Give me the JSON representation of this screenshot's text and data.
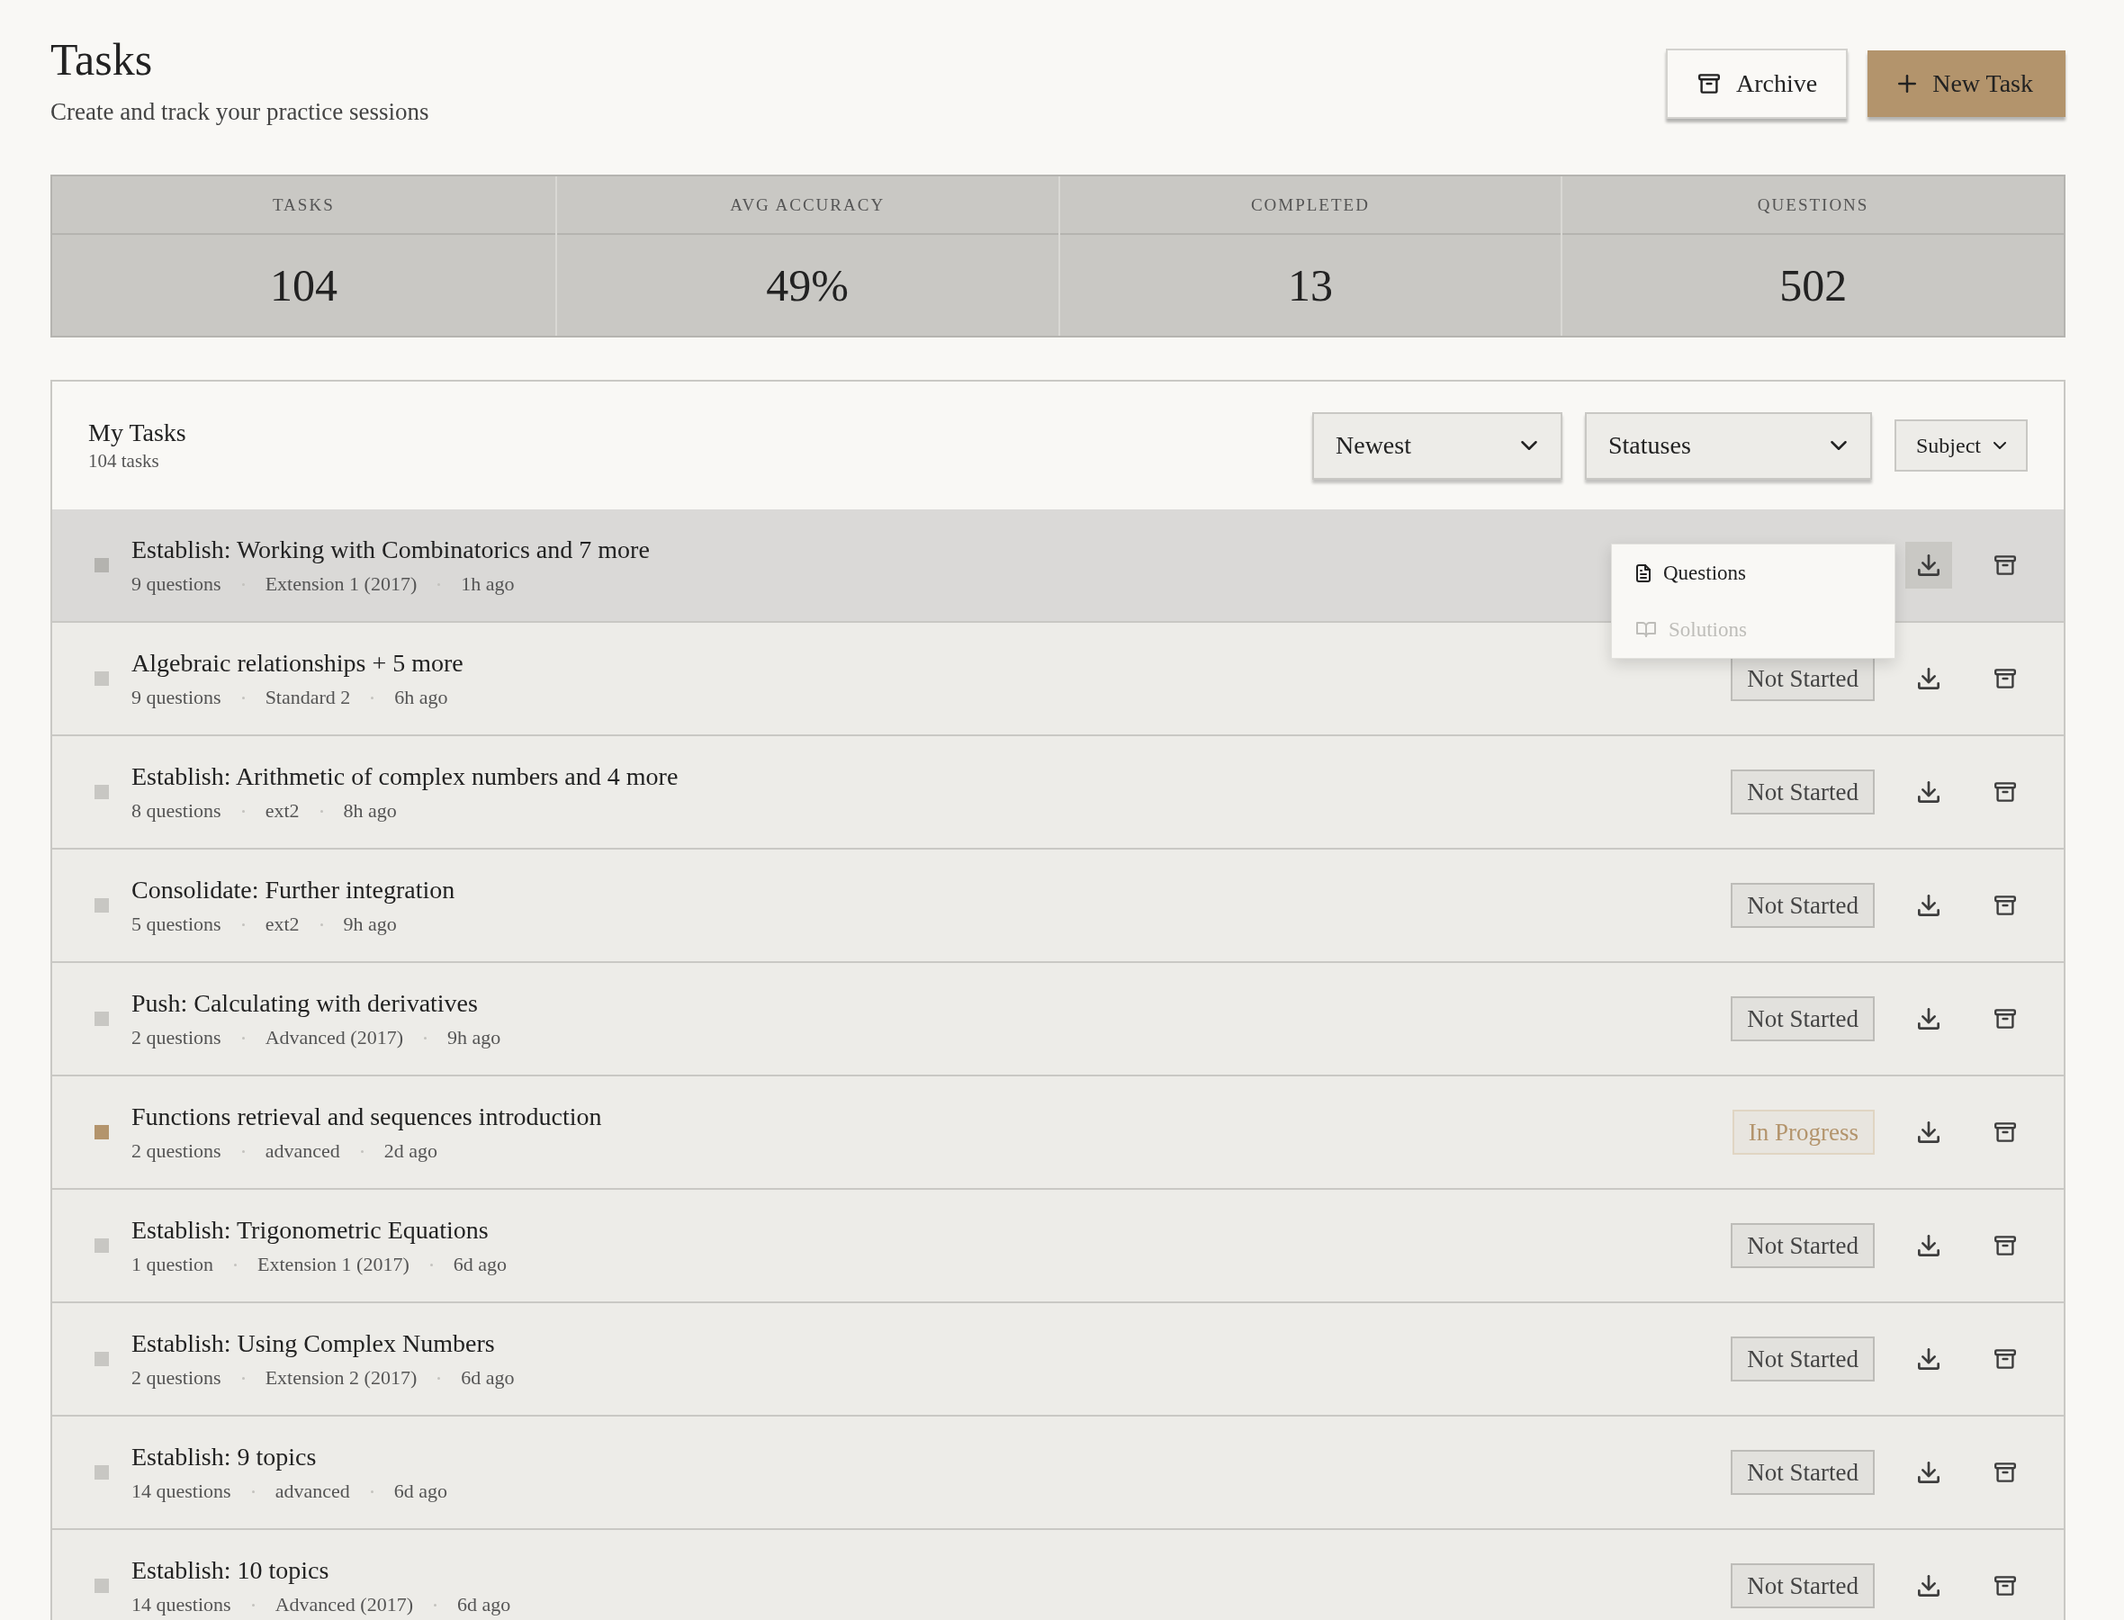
{
  "header": {
    "title": "Tasks",
    "subtitle": "Create and track your practice sessions",
    "buttons": [
      {
        "label": "Archive",
        "kind": "secondary"
      },
      {
        "label": "New Task",
        "kind": "primary"
      }
    ]
  },
  "stats": [
    {
      "label": "TASKS",
      "value": "104"
    },
    {
      "label": "AVG ACCURACY",
      "value": "49%"
    },
    {
      "label": "COMPLETED",
      "value": "13"
    },
    {
      "label": "QUESTIONS",
      "value": "502"
    }
  ],
  "task_list": {
    "title": "My Tasks",
    "count": "104 tasks",
    "filters": [
      {
        "label": "Newest",
        "kind": "large"
      },
      {
        "label": "Statuses",
        "kind": "large"
      },
      {
        "label": "Subject",
        "kind": "compact"
      }
    ],
    "download_menu": {
      "items": [
        {
          "label": "Questions",
          "kind": "document",
          "disabled": false
        },
        {
          "label": "Solutions",
          "kind": "book",
          "disabled": true
        }
      ]
    },
    "tasks": [
      {
        "title": "Establish: Working with Combinatorics and 7 more",
        "questions": "9 questions",
        "course": "Extension 1 (2017)",
        "updated": "1h ago",
        "color": "#b4b3af",
        "selected": true,
        "menu_open": true
      },
      {
        "title": "Algebraic relationships + 5 more",
        "questions": "9 questions",
        "course": "Standard 2",
        "updated": "6h ago",
        "color": "#c8c7c3",
        "selected": false,
        "menu_open": false,
        "status": {
          "label": "Not Started",
          "kind": "not_started"
        }
      },
      {
        "title": "Establish: Arithmetic of complex numbers and 4 more",
        "questions": "8 questions",
        "course": "ext2",
        "updated": "8h ago",
        "color": "#c8c7c3",
        "selected": false,
        "menu_open": false,
        "status": {
          "label": "Not Started",
          "kind": "not_started"
        }
      },
      {
        "title": "Consolidate: Further integration",
        "questions": "5 questions",
        "course": "ext2",
        "updated": "9h ago",
        "color": "#c8c7c3",
        "selected": false,
        "menu_open": false,
        "status": {
          "label": "Not Started",
          "kind": "not_started"
        }
      },
      {
        "title": "Push: Calculating with derivatives",
        "questions": "2 questions",
        "course": "Advanced (2017)",
        "updated": "9h ago",
        "color": "#c8c7c3",
        "selected": false,
        "menu_open": false,
        "status": {
          "label": "Not Started",
          "kind": "not_started"
        }
      },
      {
        "title": "Functions retrieval and sequences introduction",
        "questions": "2 questions",
        "course": "advanced",
        "updated": "2d ago",
        "color": "#b3946c",
        "selected": false,
        "menu_open": false,
        "status": {
          "label": "In Progress",
          "kind": "in_progress"
        }
      },
      {
        "title": "Establish: Trigonometric Equations",
        "questions": "1 question",
        "course": "Extension 1 (2017)",
        "updated": "6d ago",
        "color": "#c8c7c3",
        "selected": false,
        "menu_open": false,
        "status": {
          "label": "Not Started",
          "kind": "not_started"
        }
      },
      {
        "title": "Establish: Using Complex Numbers",
        "questions": "2 questions",
        "course": "Extension 2 (2017)",
        "updated": "6d ago",
        "color": "#c8c7c3",
        "selected": false,
        "menu_open": false,
        "status": {
          "label": "Not Started",
          "kind": "not_started"
        }
      },
      {
        "title": "Establish: 9 topics",
        "questions": "14 questions",
        "course": "advanced",
        "updated": "6d ago",
        "color": "#c8c7c3",
        "selected": false,
        "menu_open": false,
        "status": {
          "label": "Not Started",
          "kind": "not_started"
        }
      },
      {
        "title": "Establish: 10 topics",
        "questions": "14 questions",
        "course": "Advanced (2017)",
        "updated": "6d ago",
        "color": "#c8c7c3",
        "selected": false,
        "menu_open": false,
        "status": {
          "label": "Not Started",
          "kind": "not_started"
        }
      }
    ]
  }
}
